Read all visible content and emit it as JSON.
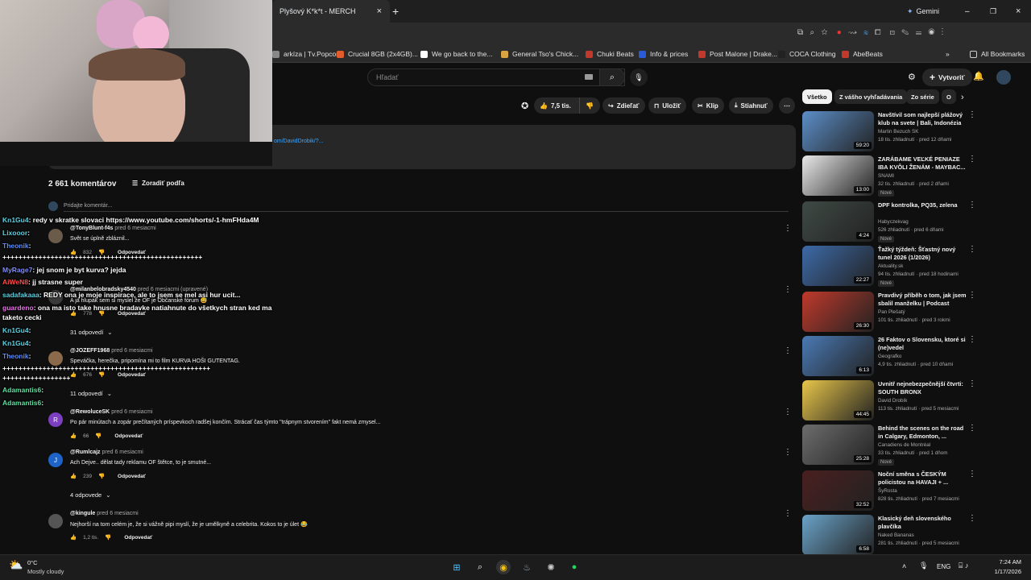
{
  "browser": {
    "tab_title": "Plyšový K*k*t - MERCH",
    "gemini_label": "Gemini",
    "bookmarks": [
      {
        "label": "arkíza | Tv.Popcor...",
        "color": "#888"
      },
      {
        "label": "Crucial 8GB (2x4GB)...",
        "color": "#e25c2c"
      },
      {
        "label": "We go back to the...",
        "color": "#ffffff"
      },
      {
        "label": "General Tso's Chick...",
        "color": "#d9a441"
      },
      {
        "label": "Chuki Beats",
        "color": "#c0392b"
      },
      {
        "label": "Info & prices",
        "color": "#2a5bd7"
      },
      {
        "label": "Post Malone | Drake...",
        "color": "#c0392b"
      },
      {
        "label": "COCA Clothing",
        "color": "#222"
      },
      {
        "label": "AbeBeats",
        "color": "#c0392b"
      }
    ],
    "all_bookmarks": "All Bookmarks"
  },
  "youtube": {
    "search_placeholder": "Hľadať",
    "create_label": "Vytvoriť",
    "actions": {
      "likes": "7,5 tis.",
      "share": "Zdieľať",
      "save": "Uložiť",
      "clip": "Klip",
      "download": "Stiahnuť"
    },
    "description_link": "om/DavidDrobik/?...",
    "comments_count": "2 661 komentárov",
    "sort_label": "Zoradiť podľa",
    "add_comment": "Pridajte komentár..."
  },
  "chat_overlay": [
    {
      "user": "Kn1Gu4",
      "color": "#5dd0e0",
      "text": ": redy v skratke slovaci https://www.youtube.com/shorts/-1-hmFHda4M"
    },
    {
      "user": "Lixooor",
      "color": "#5dd0e0",
      "text": ":"
    },
    {
      "user": "Theonik",
      "color": "#5b8cff",
      "text": ":"
    },
    {
      "user": "",
      "color": "#fff",
      "text": "++++++++++++++++++++++++++++++++++++++++++++++++++"
    },
    {
      "user": "MyRage7",
      "color": "#7f8cff",
      "text": ": jej snom je byt kurva? jejda"
    },
    {
      "user": "AiWeN8",
      "color": "#ff4d4d",
      "text": ": jj strasne super"
    },
    {
      "user": "sadafakaaa",
      "color": "#5dd0e0",
      "text": ": REDY ona je moje inspirace, ale to jsem se mel asi hur ucit..."
    },
    {
      "user": "guardeno",
      "color": "#e870e8",
      "text": ": ona ma isto take hnusne bradavke natiahnute do všetkych stran ked ma"
    },
    {
      "user": "",
      "color": "#fff",
      "text": "taketo cecki"
    },
    {
      "user": "Kn1Gu4",
      "color": "#5dd0e0",
      "text": ":"
    },
    {
      "user": "Kn1Gu4",
      "color": "#5dd0e0",
      "text": ":"
    },
    {
      "user": "Theonik",
      "color": "#5b8cff",
      "text": ":"
    },
    {
      "user": "",
      "color": "#fff",
      "text": "++++++++++++++++++++++++++++++++++++++++++++++++++++"
    },
    {
      "user": "",
      "color": "#fff",
      "text": "+++++++++++++++++"
    },
    {
      "user": "Adamantis6",
      "color": "#5de0a0",
      "text": ":"
    },
    {
      "user": "Adamantis6",
      "color": "#5de0a0",
      "text": ":"
    }
  ],
  "comments": [
    {
      "user": "@TonyBlunt-f4s",
      "time": "pred 6 mesiacmi",
      "text": "Svět se úplně zbláznil...",
      "likes": "832",
      "reply": "Odpovedať"
    },
    {
      "user": "@milanbelobradsky4540",
      "time": "pred 6 mesiacmi (upravené)",
      "text": "A já hlupák sem si myslel že OF je Občanské fórum 😅",
      "likes": "778",
      "reply": "Odpovedať",
      "replies": "31 odpovedí"
    },
    {
      "user": "@JOZEFF1968",
      "time": "pred 6 mesiacmi",
      "text": "Speváčka, herečka, pripomína mi to film KURVA HOŠI GUTENTAG.",
      "likes": "676",
      "reply": "Odpovedať",
      "replies": "11 odpovedí"
    },
    {
      "user": "@RewolucеSK",
      "time": "pred 6 mesiacmi",
      "text": "Po pár minútach a zopár prečítaných príspevkoch radšej končím. Strácať čas týmto \"trápnym stvorením\" fakt nemá zmysel...",
      "likes": "66",
      "reply": "Odpovedať",
      "avatar_letter": "R"
    },
    {
      "user": "@Rumlcajz",
      "time": "pred 6 mesiacmi",
      "text": "Ach Dejve.. dělat tady reklamu OF štětce, to je smutné...",
      "likes": "239",
      "reply": "Odpovedať",
      "replies": "4 odpovede",
      "avatar_letter": "J"
    },
    {
      "user": "@kingule",
      "time": "pred 6 mesiacmi",
      "text": "Nejhorší na tom celém je, že si vážně pipi myslí, že je umělkyně a celebrita. Kokos to je úlet 😂",
      "likes": "1,2 tis.",
      "reply": "Odpovedať"
    }
  ],
  "chips": [
    "Všetko",
    "Z vášho vyhľadávania",
    "Zo série",
    "O"
  ],
  "sidebar_videos": [
    {
      "title": "Navštívil som najlepší plážový klub na svete | Bali, Indonézia",
      "channel": "Martin Bezuch SK",
      "meta": "18 tis. zhliadnutí · pred 12 dňami",
      "duration": "59:20",
      "new": "",
      "color": "#5c8fc9"
    },
    {
      "title": "ZARÁBAME VEĽKÉ PENIAZE IBA KVÔLI ŽENÁM - MAYBAC...",
      "channel": "SNAMI",
      "meta": "32 tis. zhliadnutí · pred 2 dňami",
      "duration": "13:00",
      "new": "Nové",
      "color": "#e9e9e9"
    },
    {
      "title": "DPF kontrolka, PQ35, zelena",
      "channel": "Habyczekvag",
      "meta": "526 zhliadnutí · pred 6 dňami",
      "duration": "4:24",
      "new": "Nové",
      "color": "#3f4a45"
    },
    {
      "title": "Ťažký týždeň: Šťastný nový tunel 2026 (1/2026)",
      "channel": "Aktuality.sk",
      "meta": "94 tis. zhliadnutí · pred 18 hodinami",
      "duration": "22:27",
      "new": "Nové",
      "color": "#3d6aa8"
    },
    {
      "title": "Pravdivý příběh o tom, jak jsem sbalil manželku | Podcast",
      "channel": "Pan Plešatý",
      "meta": "101 tis. zhliadnutí · pred 3 rokmi",
      "duration": "26:30",
      "new": "",
      "color": "#c0392b"
    },
    {
      "title": "26 Faktov o Slovensku, ktoré si (ne)vedel",
      "channel": "Geografko",
      "meta": "4,9 tis. zhliadnutí · pred 10 dňami",
      "duration": "6:13",
      "new": "",
      "color": "#4a7ab5"
    },
    {
      "title": "Uvnitř nejnebezpečnější čtvrti: SOUTH BRONX",
      "channel": "David Drobík",
      "meta": "113 tis. zhliadnutí · pred 5 mesiacmi",
      "duration": "44:45",
      "new": "",
      "color": "#e8c64a"
    },
    {
      "title": "Behind the scenes on the road in Calgary, Edmonton, ...",
      "channel": "Canadiens de Montréal",
      "meta": "33 tis. zhliadnutí · pred 1 dňom",
      "duration": "25:28",
      "new": "Nové",
      "color": "#6d6d6d"
    },
    {
      "title": "Noční směna s ČESKÝM policistou na HAVAJI + ...",
      "channel": "ŠyRosta",
      "meta": "828 tis. zhliadnutí · pred 7 mesiacmi",
      "duration": "32:52",
      "new": "",
      "color": "#4a1f1f"
    },
    {
      "title": "Klasický deň slovenského plavčíka",
      "channel": "Naked Bananas",
      "meta": "281 tis. zhliadnutí · pred 5 mesiacmi",
      "duration": "6:58",
      "new": "",
      "color": "#6aa3c9"
    }
  ],
  "taskbar": {
    "weather_temp": "0°C",
    "weather_desc": "Mostly cloudy",
    "lang": "ENG",
    "time": "7:24 AM",
    "date": "1/17/2026"
  }
}
